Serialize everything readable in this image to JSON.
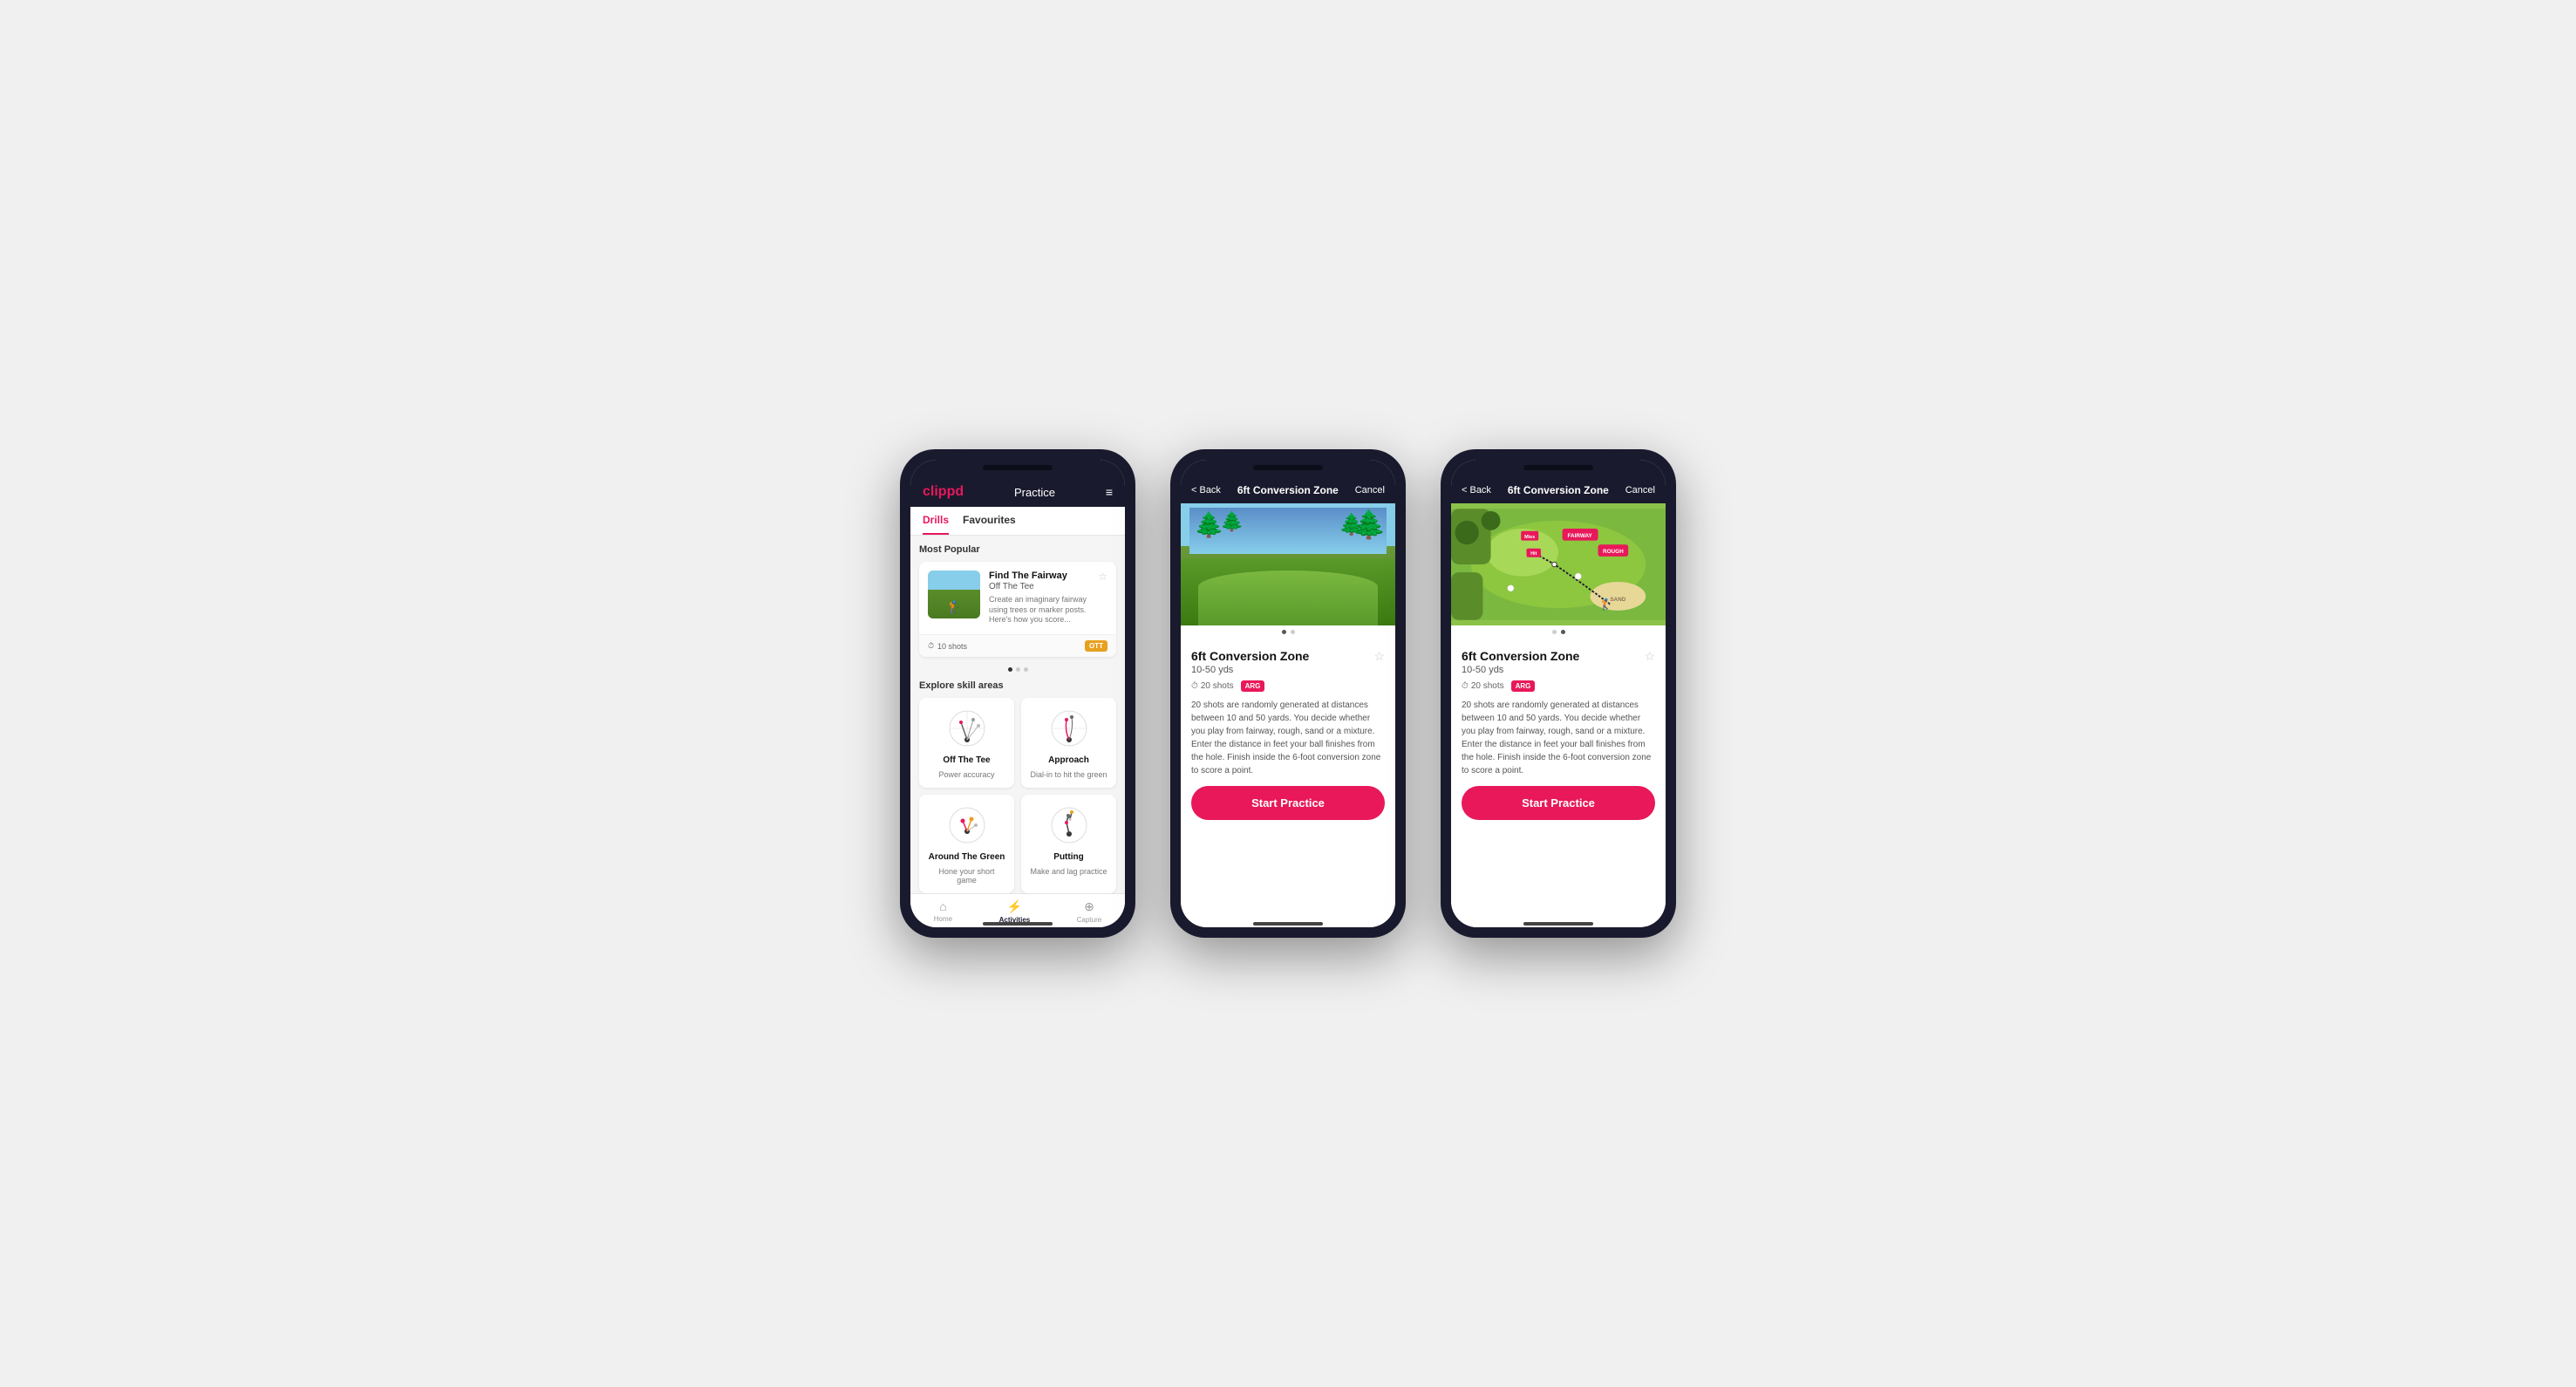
{
  "phone1": {
    "header": {
      "logo": "clippd",
      "title": "Practice",
      "menu_icon": "≡"
    },
    "tabs": [
      {
        "label": "Drills",
        "active": true
      },
      {
        "label": "Favourites",
        "active": false
      }
    ],
    "most_popular_label": "Most Popular",
    "featured_card": {
      "title": "Find The Fairway",
      "subtitle": "Off The Tee",
      "description": "Create an imaginary fairway using trees or marker posts. Here's how you score...",
      "shots": "10 shots",
      "tag": "OTT",
      "fav_icon": "☆"
    },
    "explore_label": "Explore skill areas",
    "skill_areas": [
      {
        "name": "Off The Tee",
        "desc": "Power accuracy"
      },
      {
        "name": "Approach",
        "desc": "Dial-in to hit the green"
      },
      {
        "name": "Around The Green",
        "desc": "Hone your short game"
      },
      {
        "name": "Putting",
        "desc": "Make and lag practice"
      }
    ],
    "nav_items": [
      {
        "label": "Home",
        "icon": "⌂",
        "active": false
      },
      {
        "label": "Activities",
        "icon": "⚡",
        "active": true
      },
      {
        "label": "Capture",
        "icon": "⊕",
        "active": false
      }
    ]
  },
  "phone2": {
    "header": {
      "back_label": "< Back",
      "title": "6ft Conversion Zone",
      "cancel_label": "Cancel"
    },
    "drill": {
      "title": "6ft Conversion Zone",
      "range": "10-50 yds",
      "shots": "20 shots",
      "tag": "ARG",
      "fav_icon": "☆",
      "description": "20 shots are randomly generated at distances between 10 and 50 yards. You decide whether you play from fairway, rough, sand or a mixture. Enter the distance in feet your ball finishes from the hole. Finish inside the 6-foot conversion zone to score a point.",
      "start_button": "Start Practice"
    },
    "image_type": "photo"
  },
  "phone3": {
    "header": {
      "back_label": "< Back",
      "title": "6ft Conversion Zone",
      "cancel_label": "Cancel"
    },
    "drill": {
      "title": "6ft Conversion Zone",
      "range": "10-50 yds",
      "shots": "20 shots",
      "tag": "ARG",
      "fav_icon": "☆",
      "description": "20 shots are randomly generated at distances between 10 and 50 yards. You decide whether you play from fairway, rough, sand or a mixture. Enter the distance in feet your ball finishes from the hole. Finish inside the 6-foot conversion zone to score a point.",
      "start_button": "Start Practice"
    },
    "image_type": "map"
  }
}
